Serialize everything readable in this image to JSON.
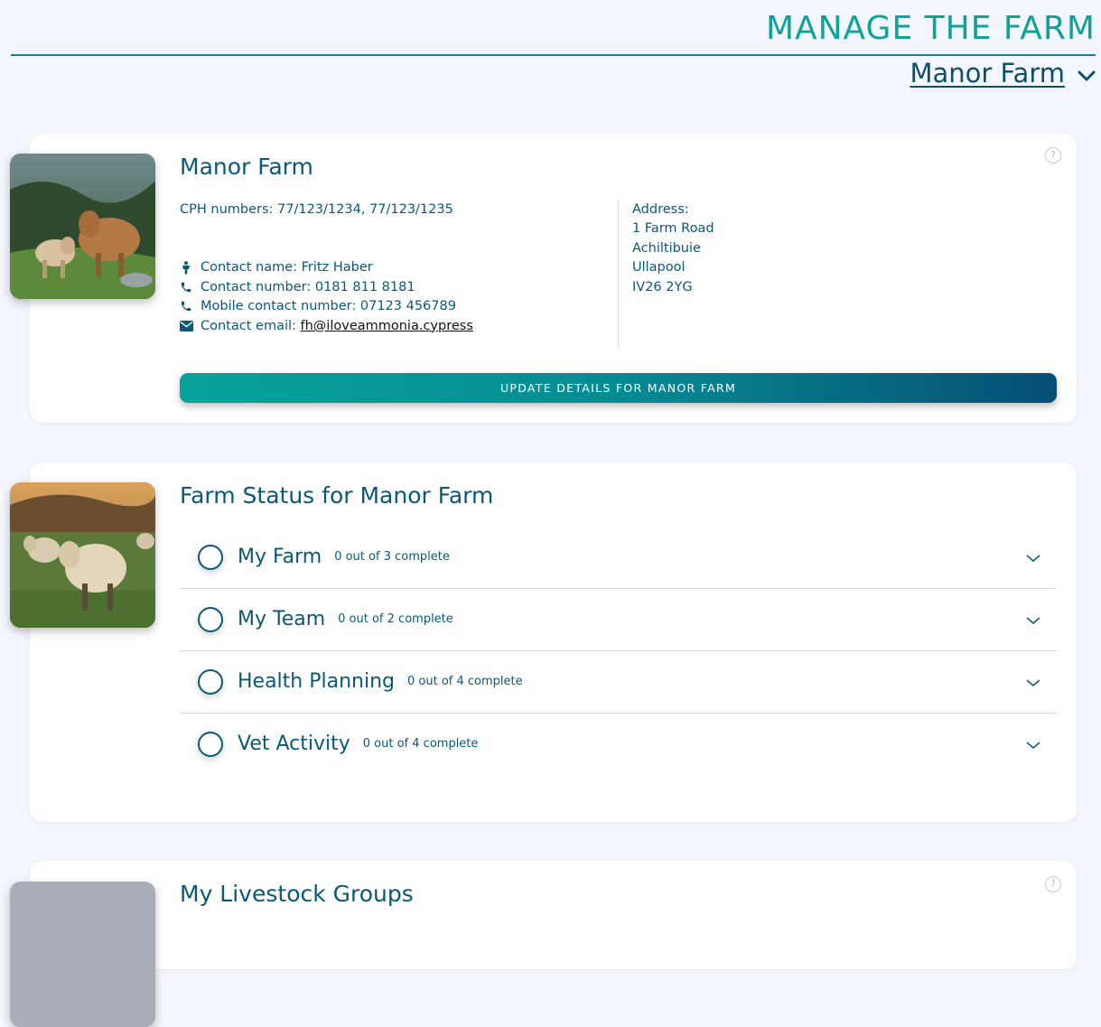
{
  "header": {
    "title": "MANAGE THE FARM",
    "farm_selector": "Manor Farm"
  },
  "details_card": {
    "title": "Manor Farm",
    "cph": "CPH numbers: 77/123/1234, 77/123/1235",
    "contact_name": "Contact name: Fritz Haber",
    "contact_number": "Contact number: 0181 811 8181",
    "mobile_number": "Mobile contact number: 07123 456789",
    "email_label": "Contact email: ",
    "email": "fh@iloveammonia.cypress",
    "address_label": "Address:",
    "address_lines": [
      "1 Farm Road",
      "Achiltibuie",
      "Ullapool",
      "IV26 2YG"
    ],
    "update_button": "UPDATE DETAILS FOR MANOR FARM"
  },
  "status_card": {
    "title": "Farm Status for Manor Farm",
    "rows": [
      {
        "title": "My Farm",
        "progress": "0 out of 3 complete"
      },
      {
        "title": "My Team",
        "progress": "0 out of 2 complete"
      },
      {
        "title": "Health Planning",
        "progress": "0 out of 4 complete"
      },
      {
        "title": "Vet Activity",
        "progress": "0 out of 4 complete"
      }
    ]
  },
  "livestock_card": {
    "title": "My Livestock Groups"
  },
  "colors": {
    "accent_teal": "#10a19a",
    "primary_navy": "#0b5876",
    "background": "#f4f6fd"
  }
}
